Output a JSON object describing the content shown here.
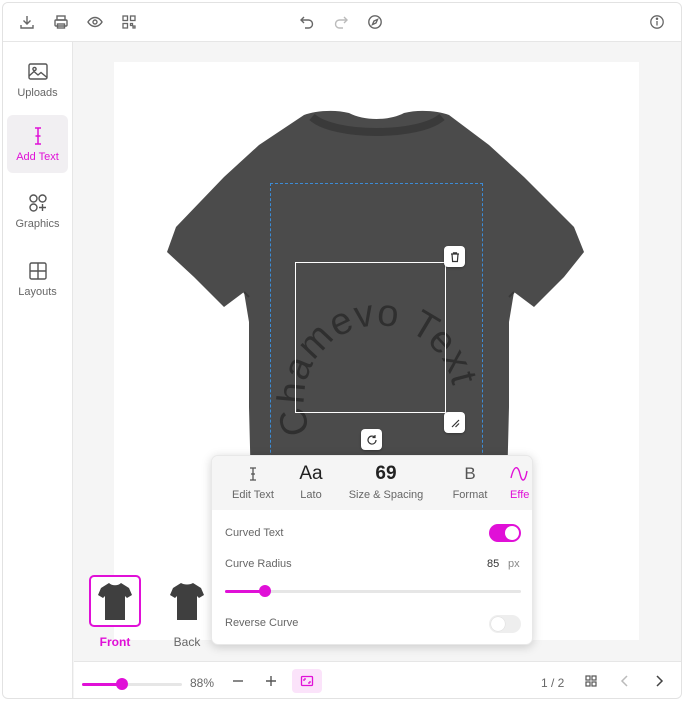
{
  "toolbar": {
    "left_icons": [
      "download-icon",
      "print-icon",
      "preview-eye-icon",
      "qr-code-icon"
    ],
    "center_icons": [
      "undo-icon",
      "redo-icon",
      "compass-icon"
    ],
    "right_icons": [
      "info-icon"
    ]
  },
  "sidebar": {
    "items": [
      {
        "label": "Uploads",
        "icon": "image-icon"
      },
      {
        "label": "Add Text",
        "icon": "text-cursor-icon"
      },
      {
        "label": "Graphics",
        "icon": "graphics-shapes-icon"
      },
      {
        "label": "Layouts",
        "icon": "grid-layout-icon"
      }
    ],
    "active": "Add Text"
  },
  "design": {
    "curved_text": "Chamevo Text",
    "shirt_color": "#4b4b4b"
  },
  "views": [
    {
      "label": "Front"
    },
    {
      "label": "Back"
    }
  ],
  "effects_panel": {
    "tabs": [
      {
        "label": "Edit Text",
        "icon": "text-cursor-icon"
      },
      {
        "label": "Lato",
        "glyph": "Aa"
      },
      {
        "label": "Size & Spacing",
        "glyph": "69"
      },
      {
        "label": "Format",
        "glyph": "B"
      },
      {
        "label": "Effe",
        "icon": "wave-icon"
      }
    ],
    "curved_text_label": "Curved Text",
    "curved_text_on": true,
    "curve_radius_label": "Curve Radius",
    "curve_radius_value": "85",
    "curve_radius_unit": "px",
    "curve_radius_fraction": 0.135,
    "reverse_curve_label": "Reverse Curve",
    "reverse_curve_on": false
  },
  "bottom": {
    "zoom_value": "88%",
    "zoom_fraction": 0.4,
    "page_indicator": "1 / 2"
  },
  "colors": {
    "accent": "#e010d7",
    "print_area_border": "#3d8bd4"
  }
}
